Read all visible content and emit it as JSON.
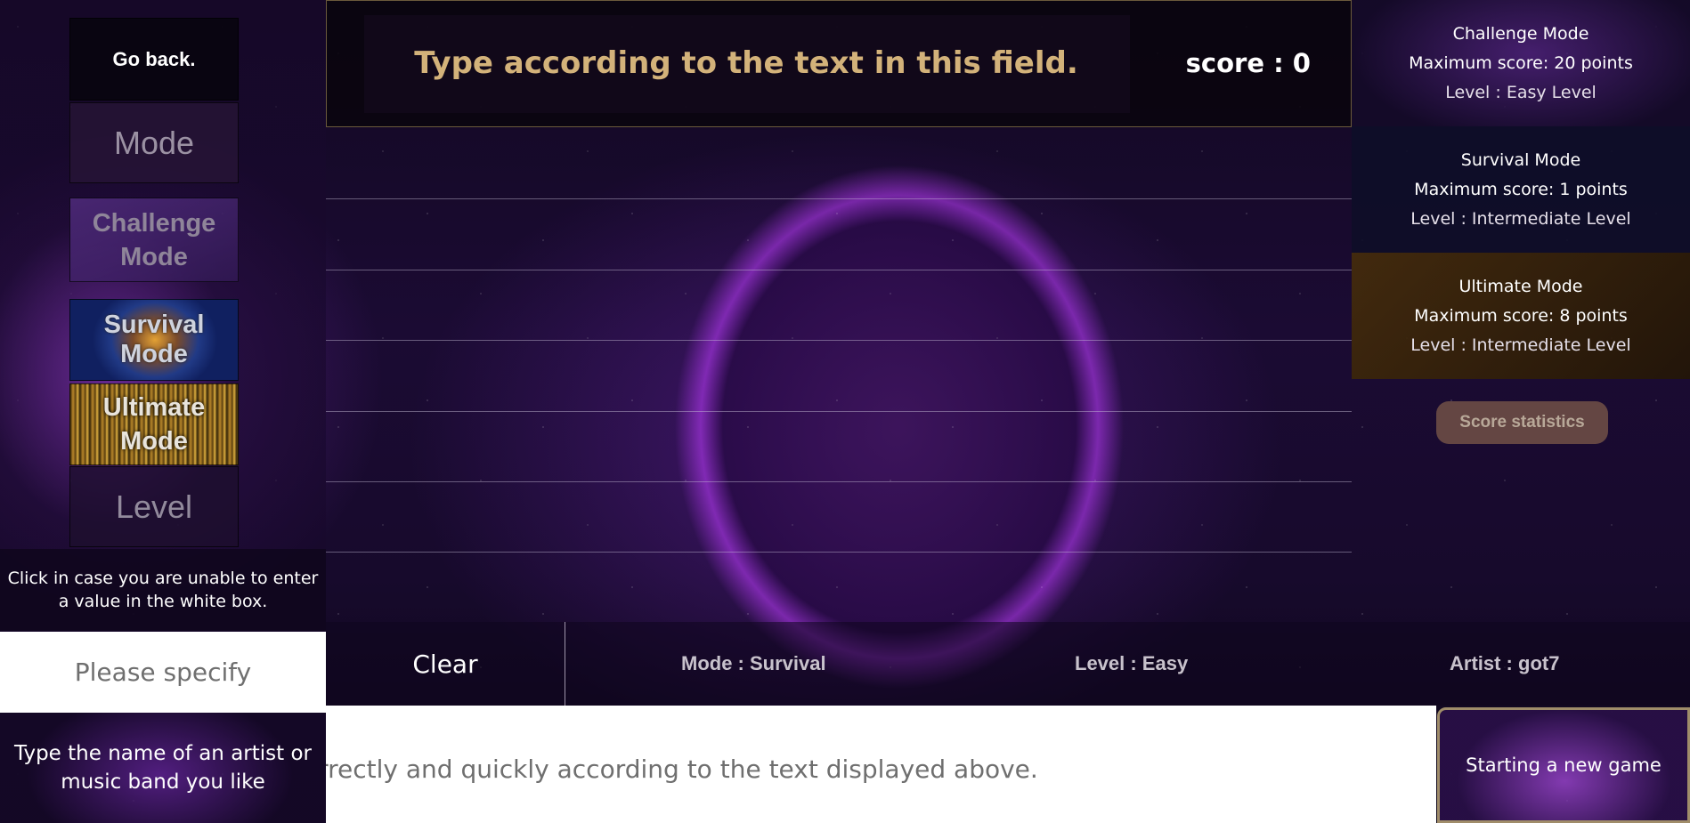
{
  "left_nav": {
    "go_back": "Go back.",
    "mode_header": "Mode",
    "challenge_mode": "Challenge Mode",
    "survival_mode": "Survival Mode",
    "ultimate_mode": "Ultimate Mode",
    "level_header": "Level"
  },
  "unable_note": "Click in case you are unable to enter a value in the white box.",
  "specify_placeholder": "Please specify",
  "artist_note": "Type the name of an artist or music band you like",
  "prompt": {
    "text": "Type according to the text in this field.",
    "score_label": "score : 0"
  },
  "mode_cards": [
    {
      "title": "Challenge Mode",
      "max_score": "Maximum score: 20 points",
      "level": "Level : Easy Level"
    },
    {
      "title": "Survival Mode",
      "max_score": "Maximum score: 1 points",
      "level": "Level : Intermediate Level"
    },
    {
      "title": "Ultimate Mode",
      "max_score": "Maximum score: 8 points",
      "level": "Level : Intermediate Level"
    }
  ],
  "score_statistics": "Score statistics",
  "info_bar": {
    "clear": "Clear",
    "mode": "Mode : Survival",
    "level": "Level : Easy",
    "artist": "Artist : got7"
  },
  "type_input_placeholder": "orrectly and quickly according to the text displayed above.",
  "new_game": "Starting a new game"
}
